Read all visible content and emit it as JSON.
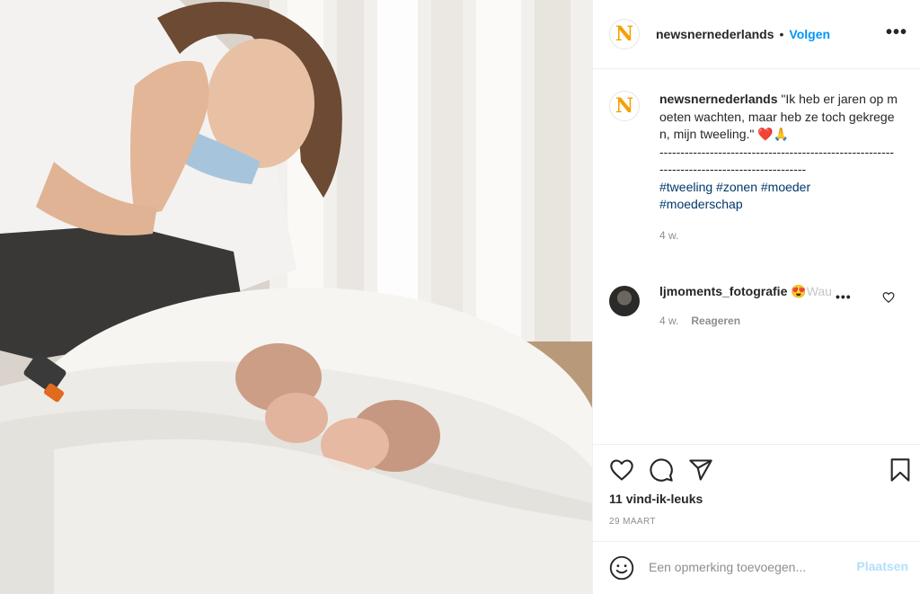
{
  "post": {
    "image_alt": "Mother with face mask smiling at newborn twins lying in a white crib",
    "account": {
      "username": "newsnernederlands",
      "logo_letter": "N",
      "separator": "•",
      "follow_label": "Volgen",
      "more_label": "•••"
    },
    "caption": {
      "username": "newsnernederlands",
      "text": "\"Ik heb er jaren op moeten wachten, maar heb ze toch gekregen, mijn tweeling.\" ",
      "emojis": "❤️🙏",
      "divider": "-------------------------------------------------------------------------------------------",
      "hashtags": [
        "#tweeling",
        "#zonen",
        "#moeder",
        "#moederschap"
      ],
      "time_ago": "4 w."
    },
    "comments": [
      {
        "username": "ljmoments_fotografie",
        "text": "😍",
        "faded_text": "Wau",
        "more": "•••",
        "time_ago": "4 w.",
        "reply_label": "Reageren"
      }
    ],
    "likes": "11 vind-ik-leuks",
    "date": "29 MAART",
    "comment_input": {
      "placeholder": "Een opmerking toevoegen...",
      "post_label": "Plaatsen"
    }
  },
  "icons": [
    "heart-icon",
    "comment-icon",
    "share-icon",
    "bookmark-icon",
    "emoji-icon",
    "small-heart-icon"
  ],
  "colors": {
    "link_blue": "#0095f6",
    "hashtag": "#00376b",
    "post_disabled": "#b2dffc",
    "logo": "#f4a100",
    "secondary_text": "#8e8e8e"
  }
}
